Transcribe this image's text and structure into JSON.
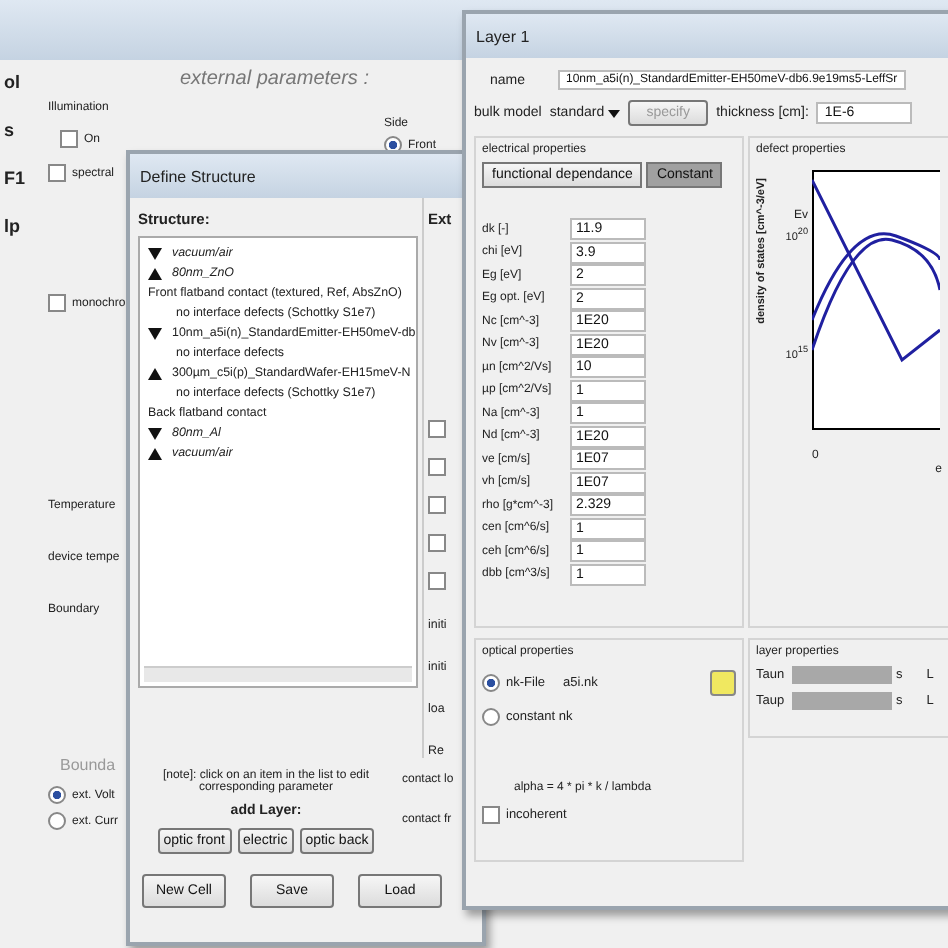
{
  "main_window": {
    "heading": "external parameters :",
    "left_labels": [
      "ol",
      "s",
      "F1",
      "lp"
    ],
    "illumination": {
      "title": "Illumination",
      "on": {
        "label": "On",
        "checked": false
      },
      "spectral": {
        "label": "spectral",
        "checked": false
      },
      "monochromatic": {
        "label": "monochro",
        "checked": false
      }
    },
    "side": {
      "title": "Side",
      "option": {
        "label": "Front",
        "selected": true
      }
    },
    "temperature": {
      "title": "Temperature",
      "label": "device tempe"
    },
    "boundary": {
      "title": "Boundary",
      "subtitle": "Bounda",
      "options": [
        {
          "label": "ext. Volt",
          "selected": true
        },
        {
          "label": "ext. Curr",
          "selected": false
        }
      ]
    }
  },
  "structure_window": {
    "title": "Define Structure",
    "heading": "Structure:",
    "side_heading": "Ext",
    "items": [
      {
        "kind": "down",
        "label": "vacuum/air",
        "italic": true
      },
      {
        "kind": "up",
        "label": "80nm_ZnO",
        "italic": true
      },
      {
        "kind": "contact",
        "label": "Front flatband contact (textured, Ref, AbsZnO)"
      },
      {
        "kind": "interface",
        "label": "no interface defects (Schottky S1e7)"
      },
      {
        "kind": "down",
        "label": "10nm_a5i(n)_StandardEmitter-EH50meV-db",
        "italic": false
      },
      {
        "kind": "interface",
        "label": "no interface defects"
      },
      {
        "kind": "up",
        "label": "300µm_c5i(p)_StandardWafer-EH15meV-N",
        "italic": false
      },
      {
        "kind": "interface",
        "label": "no interface defects (Schottky S1e7)"
      },
      {
        "kind": "contact",
        "label": "Back flatband contact"
      },
      {
        "kind": "down",
        "label": "80nm_Al",
        "italic": true
      },
      {
        "kind": "up",
        "label": "vacuum/air",
        "italic": true
      }
    ],
    "side_checks": [
      {
        "checked": false
      },
      {
        "checked": false
      },
      {
        "checked": false
      },
      {
        "checked": false
      },
      {
        "checked": false
      }
    ],
    "side_labels": [
      "initi",
      "initi",
      "loa",
      "Re"
    ],
    "contact_labels": [
      "contact lo",
      "contact fr"
    ],
    "note": "[note]: click on an item in the list to edit corresponding parameter",
    "add_layer": "add Layer:",
    "layer_buttons": [
      "optic front",
      "electric",
      "optic back"
    ],
    "buttons": [
      "New Cell",
      "Save",
      "Load"
    ]
  },
  "layer_window": {
    "title": "Layer 1",
    "name_label": "name",
    "name_value": "10nm_a5i(n)_StandardEmitter-EH50meV-db6.9e19ms5-LeffSr",
    "bulk_label": "bulk model",
    "bulk_value": "standard",
    "specify": "specify",
    "thickness_label": "thickness [cm]:",
    "thickness_value": "1E-6",
    "electrical": {
      "title": "electrical properties",
      "tabs": [
        {
          "label": "functional dependance",
          "selected": false
        },
        {
          "label": "Constant",
          "selected": true
        }
      ],
      "params": [
        {
          "label": "dk [-]",
          "value": "11.9"
        },
        {
          "label": "chi [eV]",
          "value": "3.9"
        },
        {
          "label": "Eg [eV]",
          "value": "2"
        },
        {
          "label": "Eg opt. [eV]",
          "value": "2"
        },
        {
          "label": "Nc [cm^-3]",
          "value": "1E20"
        },
        {
          "label": "Nv [cm^-3]",
          "value": "1E20"
        },
        {
          "label": "µn [cm^2/Vs]",
          "value": "10"
        },
        {
          "label": "µp [cm^2/Vs]",
          "value": "1"
        },
        {
          "label": "Na [cm^-3]",
          "value": "1"
        },
        {
          "label": "Nd [cm^-3]",
          "value": "1E20"
        },
        {
          "label": "ve [cm/s]",
          "value": "1E07"
        },
        {
          "label": "vh [cm/s]",
          "value": "1E07"
        },
        {
          "label": "rho [g*cm^-3]",
          "value": "2.329"
        },
        {
          "label": "cen [cm^6/s]",
          "value": "1"
        },
        {
          "label": "ceh [cm^6/s]",
          "value": "1"
        },
        {
          "label": "dbb [cm^3/s]",
          "value": "1"
        }
      ]
    },
    "defect": {
      "title": "defect properties",
      "ylabel": "density of states [cm^-3/eV]",
      "band_label": "Ev",
      "ticks": [
        "10$^{20}$",
        "10$^{15}$"
      ],
      "x_tick": "0",
      "edge_label": "e"
    },
    "optical": {
      "title": "optical properties",
      "options": [
        {
          "label": "nk-File",
          "selected": true,
          "file": "a5i.nk"
        },
        {
          "label": "constant nk",
          "selected": false
        }
      ],
      "formula": "alpha = 4 * pi * k / lambda",
      "incoherent": {
        "label": "incoherent",
        "checked": false
      }
    },
    "layer_props": {
      "title": "layer properties",
      "rows": [
        {
          "label": "Taun",
          "unit": "s",
          "side": "L"
        },
        {
          "label": "Taup",
          "unit": "s",
          "side": "L"
        }
      ]
    }
  }
}
